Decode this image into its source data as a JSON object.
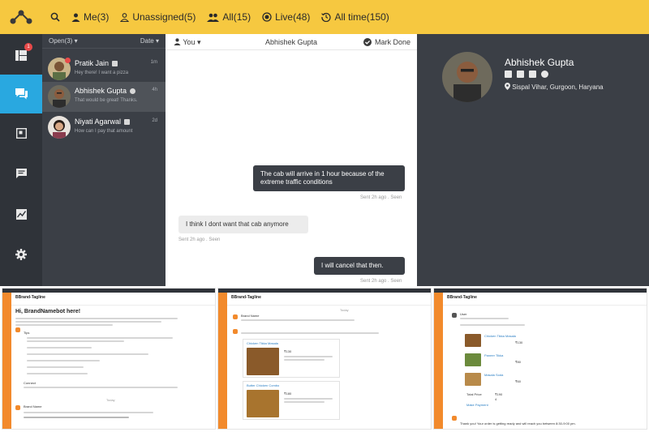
{
  "topbar": {
    "filters": [
      {
        "label": "Me(3)",
        "icon": "person-icon"
      },
      {
        "label": "Unassigned(5)",
        "icon": "person-outline-icon"
      },
      {
        "label": "All(15)",
        "icon": "people-icon"
      },
      {
        "label": "Live(48)",
        "icon": "live-icon"
      },
      {
        "label": "All time(150)",
        "icon": "history-icon"
      }
    ]
  },
  "sidebar": {
    "badge": "1"
  },
  "list": {
    "filter_label": "Open(3)",
    "sort_label": "Date",
    "items": [
      {
        "name": "Pratik Jain",
        "preview": "Hey there! I want a pizza",
        "time": "1m"
      },
      {
        "name": "Abhishek Gupta",
        "preview": "That would be great! Thanks.",
        "time": "4h"
      },
      {
        "name": "Niyati Agarwal",
        "preview": "How can I pay that amount",
        "time": "2d"
      }
    ]
  },
  "chat": {
    "assignee": "You",
    "title": "Abhishek Gupta",
    "mark_done": "Mark Done",
    "messages": [
      {
        "text": "The cab will arrive in 1 hour because of the extreme traffic conditions",
        "meta": "Sent 2h ago . Seen",
        "dir": "out"
      },
      {
        "text": "I think I dont want that cab anymore",
        "meta": "Sent 2h ago . Seen",
        "dir": "in"
      },
      {
        "text": "I will cancel that then.",
        "meta": "Sent 2h ago . Seen",
        "dir": "out"
      }
    ]
  },
  "profile": {
    "name": "Abhishek Gupta",
    "location": "Sispal Vihar, Gurgoon, Haryana"
  },
  "shots": [
    {
      "brand": "BBrand-Tagline",
      "greeting": "Hi, BrandNamebot here!",
      "tips": "Tips",
      "connect": "Connect",
      "today": "Today",
      "sender": "Brand Name"
    },
    {
      "brand": "BBrand-Tagline",
      "today": "Today",
      "sender": "Brand Name",
      "item1": "Chicken Tikka Masala",
      "item2": "Butter Chicken Combo",
      "price1": "₹130",
      "price2": "₹180"
    },
    {
      "brand": "BBrand-Tagline",
      "sender": "User",
      "item1": "Chicken Tikka Masala",
      "item2": "Paneer Tikka",
      "item3": "Masala Soda",
      "price1": "₹130",
      "price2": "₹80",
      "price3": "₹60",
      "total_label": "Total Price",
      "total": "₹190",
      "total_qty": "4",
      "confirm": "Make Payment",
      "footer": "Thank you! Your order is getting ready and will reach you between 8:30-9:00 pm."
    }
  ]
}
